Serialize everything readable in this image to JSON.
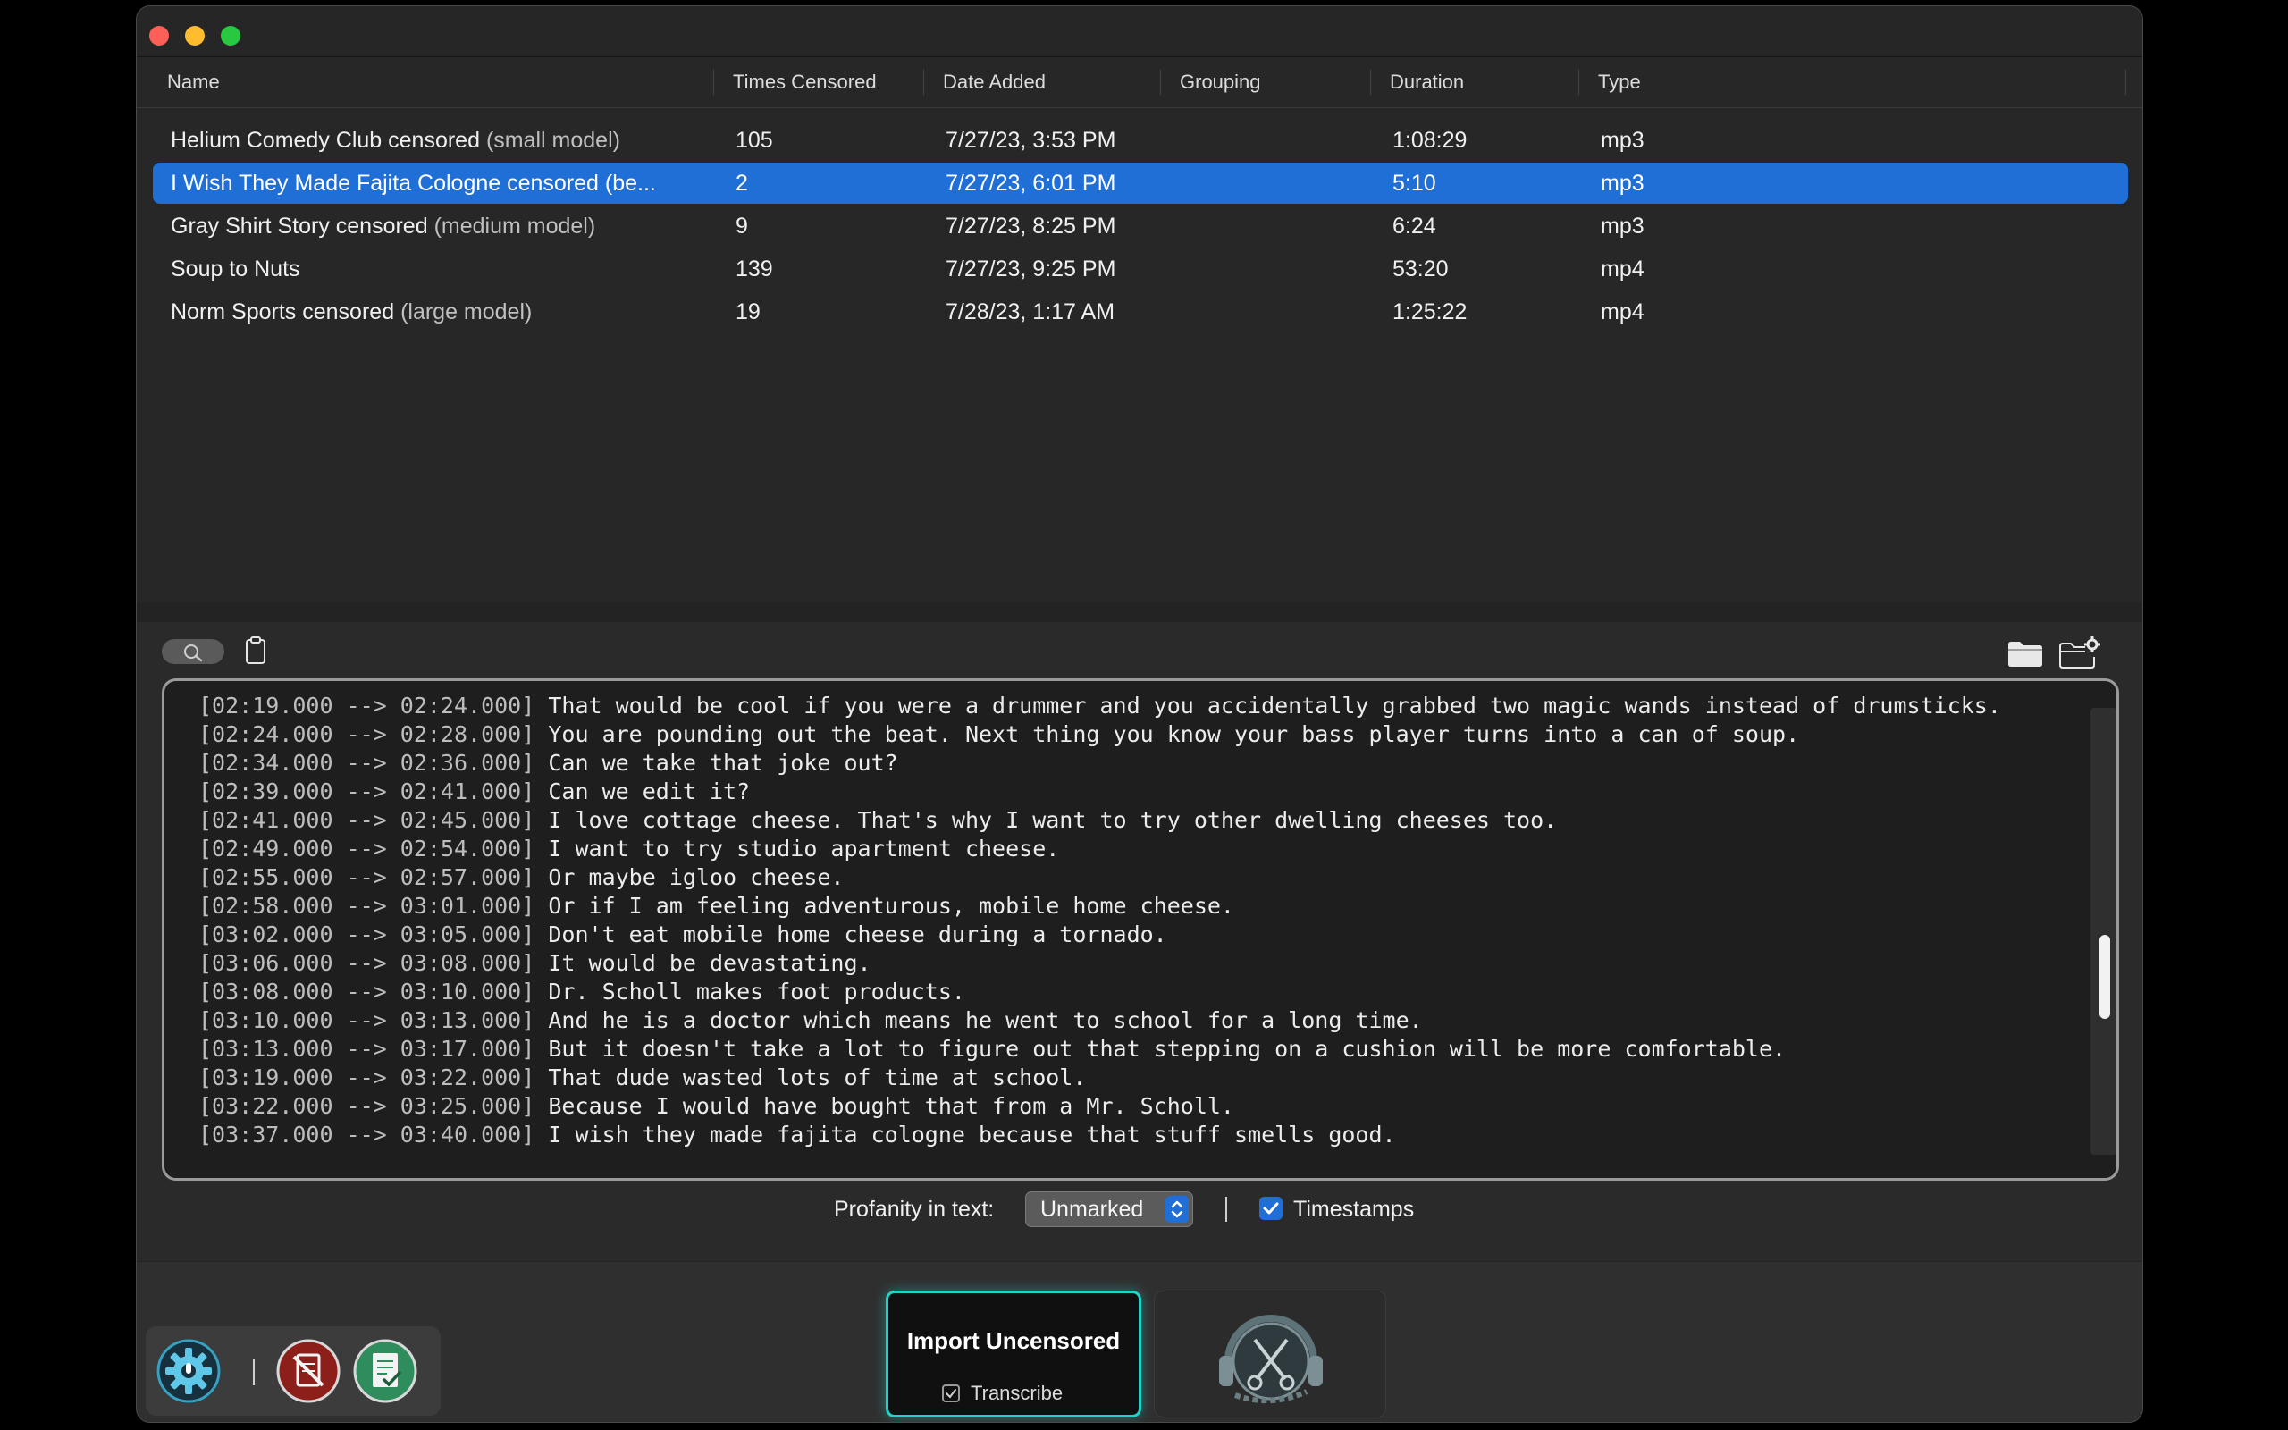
{
  "table": {
    "columns": [
      "Name",
      "Times Censored",
      "Date Added",
      "Grouping",
      "Duration",
      "Type"
    ],
    "rows": [
      {
        "name": "Helium Comedy Club censored",
        "model": "(small model)",
        "times": "105",
        "date": "7/27/23, 3:53 PM",
        "grouping": "",
        "duration": "1:08:29",
        "type": "mp3",
        "selected": false
      },
      {
        "name": "I Wish They Made Fajita Cologne censored (be...",
        "model": "",
        "times": "2",
        "date": "7/27/23, 6:01 PM",
        "grouping": "",
        "duration": "5:10",
        "type": "mp3",
        "selected": true
      },
      {
        "name": "Gray Shirt Story censored",
        "model": "(medium model)",
        "times": "9",
        "date": "7/27/23, 8:25 PM",
        "grouping": "",
        "duration": "6:24",
        "type": "mp3",
        "selected": false
      },
      {
        "name": "Soup to Nuts",
        "model": "",
        "times": "139",
        "date": "7/27/23, 9:25 PM",
        "grouping": "",
        "duration": "53:20",
        "type": "mp4",
        "selected": false
      },
      {
        "name": "Norm Sports censored",
        "model": "(large model)",
        "times": "19",
        "date": "7/28/23, 1:17 AM",
        "grouping": "",
        "duration": "1:25:22",
        "type": "mp4",
        "selected": false
      }
    ]
  },
  "transcript": {
    "lines": [
      {
        "ts": "[02:19.000 --> 02:24.000]",
        "text": "That would be cool if you were a drummer and you accidentally grabbed two magic wands instead of drumsticks."
      },
      {
        "ts": "[02:24.000 --> 02:28.000]",
        "text": "You are pounding out the beat. Next thing you know your bass player turns into a can of soup."
      },
      {
        "ts": "[02:34.000 --> 02:36.000]",
        "text": "Can we take that joke out?"
      },
      {
        "ts": "[02:39.000 --> 02:41.000]",
        "text": "Can we edit it?"
      },
      {
        "ts": "[02:41.000 --> 02:45.000]",
        "text": "I love cottage cheese. That's why I want to try other dwelling cheeses too."
      },
      {
        "ts": "[02:49.000 --> 02:54.000]",
        "text": "I want to try studio apartment cheese."
      },
      {
        "ts": "[02:55.000 --> 02:57.000]",
        "text": "Or maybe igloo cheese."
      },
      {
        "ts": "[02:58.000 --> 03:01.000]",
        "text": "Or if I am feeling adventurous, mobile home cheese."
      },
      {
        "ts": "[03:02.000 --> 03:05.000]",
        "text": "Don't eat mobile home cheese during a tornado."
      },
      {
        "ts": "[03:06.000 --> 03:08.000]",
        "text": "It would be devastating."
      },
      {
        "ts": "[03:08.000 --> 03:10.000]",
        "text": "Dr. Scholl makes foot products."
      },
      {
        "ts": "[03:10.000 --> 03:13.000]",
        "text": "And he is a doctor which means he went to school for a long time."
      },
      {
        "ts": "[03:13.000 --> 03:17.000]",
        "text": "But it doesn't take a lot to figure out that stepping on a cushion will be more comfortable."
      },
      {
        "ts": "[03:19.000 --> 03:22.000]",
        "text": "That dude wasted lots of time at school."
      },
      {
        "ts": "[03:22.000 --> 03:25.000]",
        "text": "Because I would have bought that from a Mr. Scholl."
      },
      {
        "ts": "[03:37.000 --> 03:40.000]",
        "text": "I wish they made fajita cologne because that stuff smells good."
      }
    ]
  },
  "options": {
    "profanity_label": "Profanity in text:",
    "profanity_value": "Unmarked",
    "timestamps_label": "Timestamps",
    "timestamps_checked": true
  },
  "actions": {
    "import_label": "Import Uncensored",
    "transcribe_label": "Transcribe"
  },
  "icons": {
    "settings": "gear-icon",
    "censor": "no-document-icon",
    "report": "checklist-icon",
    "logo": "headphones-scissors-logo",
    "folder": "folder-icon",
    "folder_settings": "folder-gear-icon",
    "search": "search-icon",
    "clipboard": "clipboard-icon"
  },
  "colors": {
    "selection": "#1f6fd6",
    "accent_teal": "#22d2c6",
    "close": "#fe5f57",
    "minimize": "#febc2e",
    "maximize": "#28c840"
  }
}
